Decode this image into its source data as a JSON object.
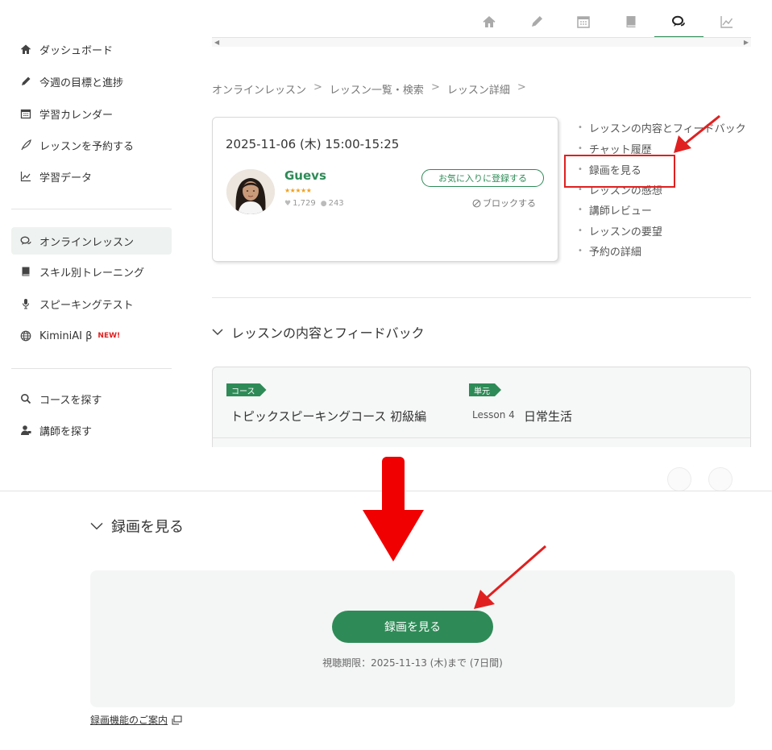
{
  "sidebar": {
    "items": [
      {
        "label": "ダッシュボード",
        "icon": "home-icon"
      },
      {
        "label": "今週の目標と進捗",
        "icon": "pencil-icon"
      },
      {
        "label": "学習カレンダー",
        "icon": "calendar-icon"
      },
      {
        "label": "レッスンを予約する",
        "icon": "quill-icon"
      },
      {
        "label": "学習データ",
        "icon": "line-chart-icon"
      },
      {
        "label": "オンラインレッスン",
        "icon": "chat-bubbles-icon",
        "active": true
      },
      {
        "label": "スキル別トレーニング",
        "icon": "book-icon"
      },
      {
        "label": "スピーキングテスト",
        "icon": "microphone-icon"
      },
      {
        "label": "KiminiAI β",
        "icon": "globe-icon",
        "badge": "NEW!"
      },
      {
        "label": "コースを探す",
        "icon": "search-icon"
      },
      {
        "label": "講師を探す",
        "icon": "teacher-icon"
      }
    ]
  },
  "topnav": {
    "icons": [
      "home-icon",
      "pencil-icon",
      "calendar-icon",
      "book-icon",
      "chat-bubbles-icon",
      "line-chart-icon"
    ],
    "active_icon": "chat-bubbles-icon"
  },
  "breadcrumb": {
    "items": [
      "オンラインレッスン",
      "レッスン一覧・検索",
      "レッスン詳細"
    ],
    "separator": ">"
  },
  "lesson": {
    "datetime": "2025-11-06 (木) 15:00-15:25",
    "teacher_name": "Guevs",
    "rating_stars": 4.5,
    "stars_text": "★★★★★",
    "likes": "1,729",
    "comments": "243",
    "favorite_label": "お気に入りに登録する",
    "block_label": "ブロックする"
  },
  "anchors": [
    "レッスンの内容とフィードバック",
    "チャット履歴",
    "録画を見る",
    "レッスンの感想",
    "講師レビュー",
    "レッスンの要望",
    "予約の詳細"
  ],
  "feedback_section": {
    "heading": "レッスンの内容とフィードバック",
    "course_tag": "コース",
    "course_name": "トピックスピーキングコース 初級編",
    "unit_tag": "単元",
    "lesson_number": "Lesson 4",
    "lesson_title": "日常生活"
  },
  "recording": {
    "heading": "録画を見る",
    "button_label": "録画を見る",
    "expiry": "視聴期限：2025-11-13 (木)まで (7日間)",
    "guide_link": "録画機能のご案内"
  },
  "colors": {
    "brand_green": "#2e8b57",
    "annotation_red": "#e02020",
    "big_arrow_red": "#f00000"
  }
}
